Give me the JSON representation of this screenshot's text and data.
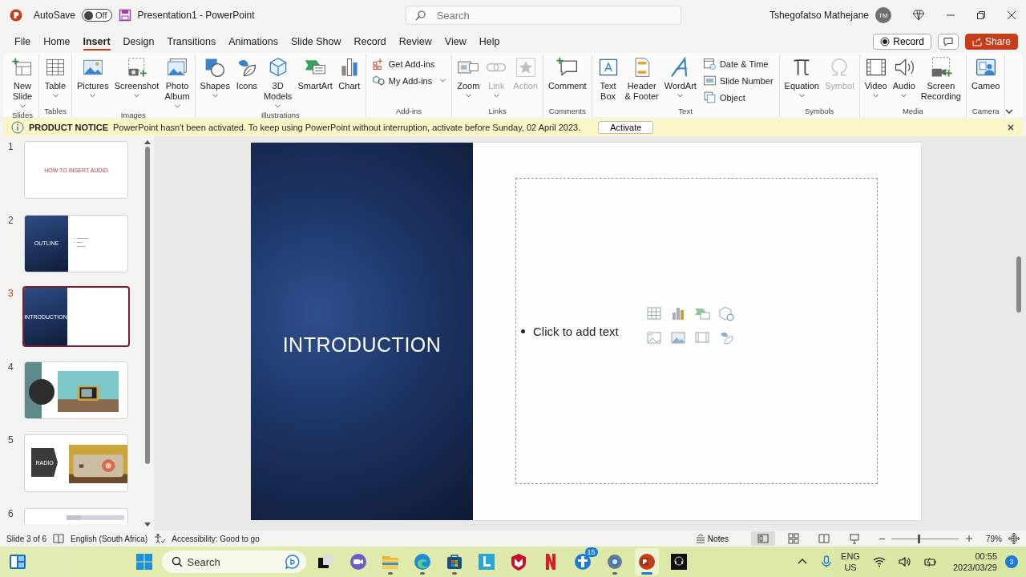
{
  "title_bar": {
    "autosave_label": "AutoSave",
    "autosave": {
      "on": false,
      "label": "Off"
    },
    "document_title": "Presentation1  -  PowerPoint",
    "search": {
      "placeholder": "Search"
    },
    "user_name": "Tshegofatso Mathejane",
    "avatar": "TM"
  },
  "menu_tabs": [
    {
      "label": "File",
      "selected": false
    },
    {
      "label": "Home",
      "selected": false
    },
    {
      "label": "Insert",
      "selected": true
    },
    {
      "label": "Design",
      "selected": false
    },
    {
      "label": "Transitions",
      "selected": false
    },
    {
      "label": "Animations",
      "selected": false
    },
    {
      "label": "Slide Show",
      "selected": false
    },
    {
      "label": "Record",
      "selected": false
    },
    {
      "label": "Review",
      "selected": false
    },
    {
      "label": "View",
      "selected": false
    },
    {
      "label": "Help",
      "selected": false
    }
  ],
  "header_buttons": {
    "record": "Record",
    "share": "Share"
  },
  "ribbon": {
    "groups": [
      {
        "label": "Slides",
        "items": [
          {
            "kind": "large",
            "label": "New\nSlide",
            "dropdown": true,
            "disabled": false
          }
        ]
      },
      {
        "label": "Tables",
        "items": [
          {
            "kind": "large",
            "label": "Table",
            "dropdown": true,
            "disabled": false
          }
        ]
      },
      {
        "label": "Images",
        "items": [
          {
            "kind": "large",
            "label": "Pictures",
            "dropdown": true,
            "disabled": false
          },
          {
            "kind": "large",
            "label": "Screenshot",
            "dropdown": true,
            "disabled": false
          },
          {
            "kind": "large",
            "label": "Photo\nAlbum",
            "dropdown": true,
            "disabled": false
          }
        ]
      },
      {
        "label": "Illustrations",
        "items": [
          {
            "kind": "large",
            "label": "Shapes",
            "dropdown": true,
            "disabled": false
          },
          {
            "kind": "large",
            "label": "Icons",
            "dropdown": false,
            "disabled": false
          },
          {
            "kind": "large",
            "label": "3D\nModels",
            "dropdown": true,
            "disabled": false
          },
          {
            "kind": "large",
            "label": "SmartArt",
            "dropdown": false,
            "disabled": false
          },
          {
            "kind": "large",
            "label": "Chart",
            "dropdown": false,
            "disabled": false
          }
        ]
      },
      {
        "label": "Add-ins",
        "items": [
          {
            "kind": "small",
            "label": "Get Add-ins",
            "dropdown": false,
            "disabled": false
          },
          {
            "kind": "small",
            "label": "My Add-ins",
            "dropdown": true,
            "disabled": false
          }
        ]
      },
      {
        "label": "Links",
        "items": [
          {
            "kind": "large",
            "label": "Zoom",
            "dropdown": true,
            "disabled": false
          },
          {
            "kind": "large",
            "label": "Link",
            "dropdown": true,
            "disabled": true
          },
          {
            "kind": "large",
            "label": "Action",
            "dropdown": false,
            "disabled": true
          }
        ]
      },
      {
        "label": "Comments",
        "items": [
          {
            "kind": "large",
            "label": "Comment",
            "dropdown": false,
            "disabled": false
          }
        ]
      },
      {
        "label": "Text",
        "items": [
          {
            "kind": "large",
            "label": "Text\nBox",
            "dropdown": false,
            "disabled": false
          },
          {
            "kind": "large",
            "label": "Header\n& Footer",
            "dropdown": false,
            "disabled": false
          },
          {
            "kind": "large",
            "label": "WordArt",
            "dropdown": true,
            "disabled": false
          },
          {
            "kind": "small",
            "label": "Date & Time",
            "dropdown": false,
            "disabled": false
          },
          {
            "kind": "small",
            "label": "Slide Number",
            "dropdown": false,
            "disabled": false
          },
          {
            "kind": "small",
            "label": "Object",
            "dropdown": false,
            "disabled": false
          }
        ]
      },
      {
        "label": "Symbols",
        "items": [
          {
            "kind": "large",
            "label": "Equation",
            "dropdown": true,
            "disabled": false
          },
          {
            "kind": "large",
            "label": "Symbol",
            "dropdown": false,
            "disabled": true
          }
        ]
      },
      {
        "label": "Media",
        "items": [
          {
            "kind": "large",
            "label": "Video",
            "dropdown": true,
            "disabled": false
          },
          {
            "kind": "large",
            "label": "Audio",
            "dropdown": true,
            "disabled": false
          },
          {
            "kind": "large",
            "label": "Screen\nRecording",
            "dropdown": false,
            "disabled": false
          }
        ]
      },
      {
        "label": "Camera",
        "items": [
          {
            "kind": "large",
            "label": "Cameo",
            "dropdown": false,
            "disabled": false
          }
        ]
      }
    ]
  },
  "notice": {
    "title": "PRODUCT NOTICE",
    "message": "PowerPoint hasn't been activated. To keep using PowerPoint without interruption, activate before Sunday, 02 April 2023.",
    "button": "Activate"
  },
  "slides": [
    {
      "number": "1",
      "kind": "title",
      "title": "HOW TO INSERT AUDIO",
      "selected": false
    },
    {
      "number": "2",
      "kind": "section",
      "title": "OUTLINE",
      "bullets": true,
      "selected": false
    },
    {
      "number": "3",
      "kind": "section",
      "title": "INTRODUCTION",
      "bullets": false,
      "selected": true
    },
    {
      "number": "4",
      "kind": "circle-picture",
      "selected": false
    },
    {
      "number": "5",
      "kind": "arrow-picture",
      "title": "RADIO",
      "selected": false
    },
    {
      "number": "6",
      "kind": "partial",
      "selected": false
    }
  ],
  "current_slide": {
    "title": "INTRODUCTION",
    "placeholder": "Click to add text"
  },
  "status_bar": {
    "slide_info": "Slide 3 of 6",
    "language": "English (South Africa)",
    "accessibility": "Accessibility: Good to go",
    "notes": "Notes",
    "views": [
      {
        "selected": true
      },
      {
        "selected": false
      },
      {
        "selected": false
      },
      {
        "selected": false
      }
    ],
    "zoom": {
      "level": 0.4,
      "reading": "79%"
    }
  },
  "taskbar": {
    "search": {
      "placeholder": "Search"
    },
    "apps": [
      {
        "running": false,
        "active": false
      },
      {
        "running": false,
        "active": false
      },
      {
        "running": true,
        "active": false
      },
      {
        "running": true,
        "active": false
      },
      {
        "running": true,
        "active": false
      },
      {
        "running": false,
        "active": false
      },
      {
        "running": false,
        "active": false
      },
      {
        "running": false,
        "active": false
      },
      {
        "running": false,
        "active": false,
        "badge": "15"
      },
      {
        "running": true,
        "active": false
      },
      {
        "running": true,
        "active": true
      },
      {
        "running": false,
        "active": false
      }
    ],
    "language": "ENG",
    "region": "US",
    "time": "00:55",
    "date": "2023/03/29",
    "notifications": "3"
  }
}
